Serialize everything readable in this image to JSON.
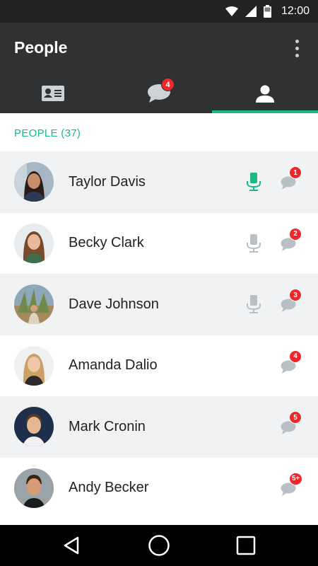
{
  "status_bar": {
    "time": "12:00"
  },
  "app_bar": {
    "title": "People"
  },
  "tabs": [
    {
      "icon": "contact-card-icon"
    },
    {
      "icon": "chat-bubble-icon",
      "badge": "4"
    },
    {
      "icon": "person-icon",
      "active": true
    }
  ],
  "section": {
    "header": "PEOPLE (37)"
  },
  "people": [
    {
      "name": "Taylor Davis",
      "mic": "active",
      "chat_badge": "1"
    },
    {
      "name": "Becky Clark",
      "mic": "inactive",
      "chat_badge": "2"
    },
    {
      "name": "Dave Johnson",
      "mic": "inactive",
      "chat_badge": "3"
    },
    {
      "name": "Amanda Dalio",
      "mic": "none",
      "chat_badge": "4"
    },
    {
      "name": "Mark Cronin",
      "mic": "none",
      "chat_badge": "5"
    },
    {
      "name": "Andy Becker",
      "mic": "none",
      "chat_badge": "5+"
    }
  ],
  "colors": {
    "accent": "#1eb980",
    "badge": "#f0262b",
    "app_bar": "#2f3133",
    "mic_inactive": "#b9c0c4"
  }
}
